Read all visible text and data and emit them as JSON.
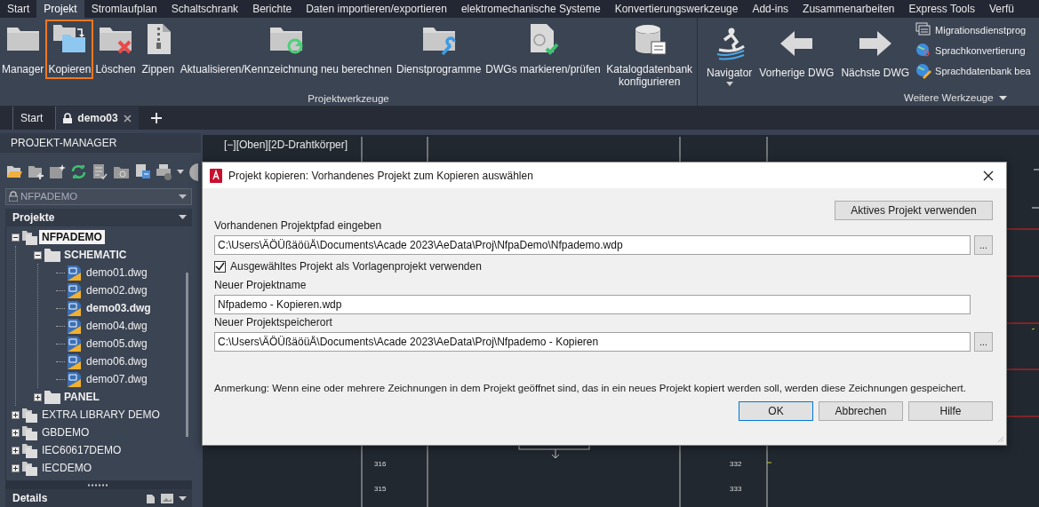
{
  "menu_tabs": [
    {
      "label": "Start",
      "selected": false
    },
    {
      "label": "Projekt",
      "selected": true
    },
    {
      "label": "Stromlaufplan",
      "selected": false
    },
    {
      "label": "Schaltschrank",
      "selected": false
    },
    {
      "label": "Berichte",
      "selected": false
    },
    {
      "label": "Daten importieren/exportieren",
      "selected": false
    },
    {
      "label": "elektromechanische Systeme",
      "selected": false
    },
    {
      "label": "Konvertierungswerkzeuge",
      "selected": false
    },
    {
      "label": "Add-ins",
      "selected": false
    },
    {
      "label": "Zusammenarbeiten",
      "selected": false
    },
    {
      "label": "Express Tools",
      "selected": false
    },
    {
      "label": "Verfü",
      "selected": false
    }
  ],
  "ribbon": {
    "panels": [
      {
        "title": "Projektwerkzeuge",
        "buttons": [
          {
            "label": "Manager",
            "highlighted": false
          },
          {
            "label": "Kopieren",
            "highlighted": true
          },
          {
            "label": "Löschen",
            "highlighted": false
          },
          {
            "label": "Zippen",
            "highlighted": false
          },
          {
            "label": "Aktualisieren/Kennzeichnung neu berechnen",
            "highlighted": false
          },
          {
            "label": "Dienstprogramme",
            "highlighted": false
          },
          {
            "label": "DWGs markieren/prüfen",
            "highlighted": false
          },
          {
            "label": "Katalogdatenbank konfigurieren",
            "highlighted": false
          }
        ]
      },
      {
        "title": "Weitere Werkzeuge",
        "buttons": [
          {
            "label": "Navigator",
            "highlighted": false
          },
          {
            "label": "Vorherige DWG",
            "highlighted": false
          },
          {
            "label": "Nächste DWG",
            "highlighted": false
          }
        ],
        "small_buttons": [
          "Migrationsdienstprog",
          "Sprachkonvertierung",
          "Sprachdatenbank bea"
        ]
      }
    ]
  },
  "doc_tabs": [
    {
      "label": "Start",
      "selected": false,
      "locked": false,
      "closable": false
    },
    {
      "label": "demo03",
      "selected": true,
      "locked": true,
      "closable": true
    }
  ],
  "project_manager": {
    "title": "PROJEKT-MANAGER",
    "project_dropdown": "NFPADEMO",
    "section": "Projekte",
    "details": "Details",
    "tree": [
      {
        "label": "NFPADEMO",
        "kind": "project",
        "expanded": true,
        "selected": true,
        "children": [
          {
            "label": "SCHEMATIC",
            "kind": "folder",
            "expanded": true,
            "selected": false,
            "children": [
              {
                "label": "demo01.dwg",
                "kind": "drawing",
                "selected": false,
                "current": false
              },
              {
                "label": "demo02.dwg",
                "kind": "drawing",
                "selected": false,
                "current": false
              },
              {
                "label": "demo03.dwg",
                "kind": "drawing",
                "selected": false,
                "current": true
              },
              {
                "label": "demo04.dwg",
                "kind": "drawing",
                "selected": false,
                "current": false
              },
              {
                "label": "demo05.dwg",
                "kind": "drawing",
                "selected": false,
                "current": false
              },
              {
                "label": "demo06.dwg",
                "kind": "drawing",
                "selected": false,
                "current": false
              },
              {
                "label": "demo07.dwg",
                "kind": "drawing",
                "selected": false,
                "current": false
              }
            ]
          },
          {
            "label": "PANEL",
            "kind": "folder",
            "expanded": false,
            "selected": false
          }
        ]
      },
      {
        "label": "EXTRA LIBRARY DEMO",
        "kind": "project",
        "expanded": false,
        "selected": false
      },
      {
        "label": "GBDEMO",
        "kind": "project",
        "expanded": false,
        "selected": false
      },
      {
        "label": "IEC60617DEMO",
        "kind": "project",
        "expanded": false,
        "selected": false
      },
      {
        "label": "IECDEMO",
        "kind": "project",
        "expanded": false,
        "selected": false
      }
    ]
  },
  "viewport": {
    "label": "[−][Oben][2D-Drahtkörper]",
    "numbers": [
      "316",
      "315",
      "332",
      "333"
    ]
  },
  "dialog": {
    "title": "Projekt kopieren: Vorhandenes Projekt zum Kopieren auswählen",
    "active_project_button": "Aktives Projekt verwenden",
    "fields": [
      {
        "label": "Vorhandenen Projektpfad eingeben",
        "value": "C:\\Users\\ÄÖÜßäöüÅ\\Documents\\Acade 2023\\AeData\\Proj\\NfpaDemo\\Nfpademo.wdp",
        "browse": "..."
      }
    ],
    "checkbox": {
      "label": "Ausgewähltes Projekt als Vorlagenprojekt verwenden",
      "checked": true
    },
    "fields2": [
      {
        "label": "Neuer Projektname",
        "value": "Nfpademo - Kopieren.wdp"
      },
      {
        "label": "Neuer Projektspeicherort",
        "value": "C:\\Users\\ÄÖÜßäöüÅ\\Documents\\Acade 2023\\AeData\\Proj\\Nfpademo - Kopieren",
        "browse": "..."
      }
    ],
    "note": "Anmerkung: Wenn eine oder mehrere Zeichnungen in dem Projekt geöffnet sind, das in ein neues Projekt kopiert werden soll, werden diese Zeichnungen gespeichert.",
    "buttons": [
      {
        "label": "OK",
        "default": true
      },
      {
        "label": "Abbrechen",
        "default": false
      },
      {
        "label": "Hilfe",
        "default": false
      }
    ]
  }
}
